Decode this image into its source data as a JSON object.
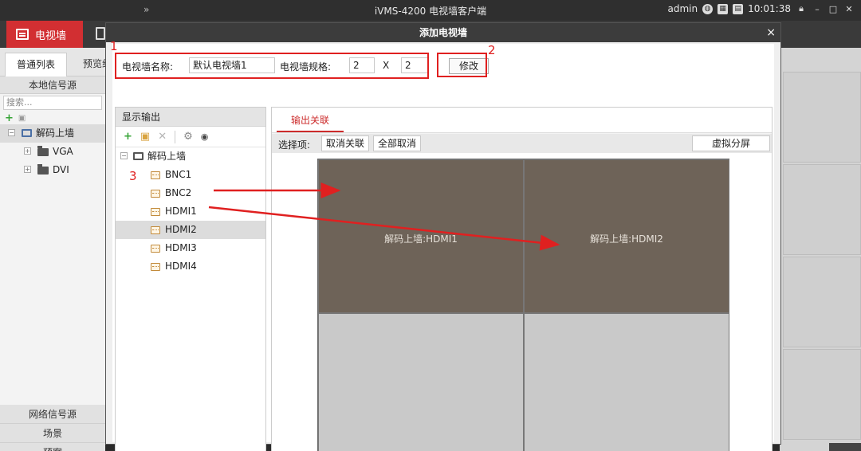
{
  "titlebar": {
    "double_chevron": "»",
    "app_title": "iVMS-4200 电视墙客户端",
    "user": "admin",
    "time": "10:01:38",
    "icons": [
      "globe-icon",
      "keyboard-icon",
      "calculator-icon",
      "lock-icon",
      "minimize-icon",
      "maximize-icon",
      "close-icon"
    ]
  },
  "modules": {
    "tv_wall": "电视墙"
  },
  "left": {
    "tabs": [
      "普通列表",
      "预览组"
    ],
    "local_source": "本地信号源",
    "search_placeholder": "搜索...",
    "tree": {
      "root": "解码上墙",
      "children": [
        "VGA",
        "DVI"
      ]
    },
    "network_source": "网络信号源",
    "scene": "场景",
    "preview": "预案"
  },
  "dialog": {
    "title": "添加电视墙",
    "close": "×",
    "name_label": "电视墙名称:",
    "name_value": "默认电视墙1",
    "spec_label": "电视墙规格:",
    "rows_value": "2",
    "times": "X",
    "cols_value": "2",
    "modify_button": "修改",
    "output_panel": {
      "title": "显示输出",
      "tools": [
        "add-icon",
        "folder-icon",
        "delete-icon",
        "gear-icon",
        "eye-icon"
      ],
      "root": "解码上墙",
      "ports": [
        "BNC1",
        "BNC2",
        "HDMI1",
        "HDMI2",
        "HDMI3",
        "HDMI4"
      ],
      "selected_port": "HDMI2"
    },
    "assoc_panel": {
      "tab": "输出关联",
      "select_label": "选择项:",
      "cancel_assoc": "取消关联",
      "cancel_all": "全部取消",
      "virtual_split": "虚拟分屏",
      "screens": [
        {
          "label": "解码上墙:HDMI1",
          "bound": true
        },
        {
          "label": "解码上墙:HDMI2",
          "bound": true
        },
        {
          "label": "",
          "bound": false
        },
        {
          "label": "",
          "bound": false
        }
      ]
    }
  },
  "annotations": {
    "step1": "1",
    "step2": "2",
    "step3": "3",
    "color": "#e02020"
  },
  "colors": {
    "accent": "#d22f32",
    "bound_screen": "#6e6358"
  }
}
